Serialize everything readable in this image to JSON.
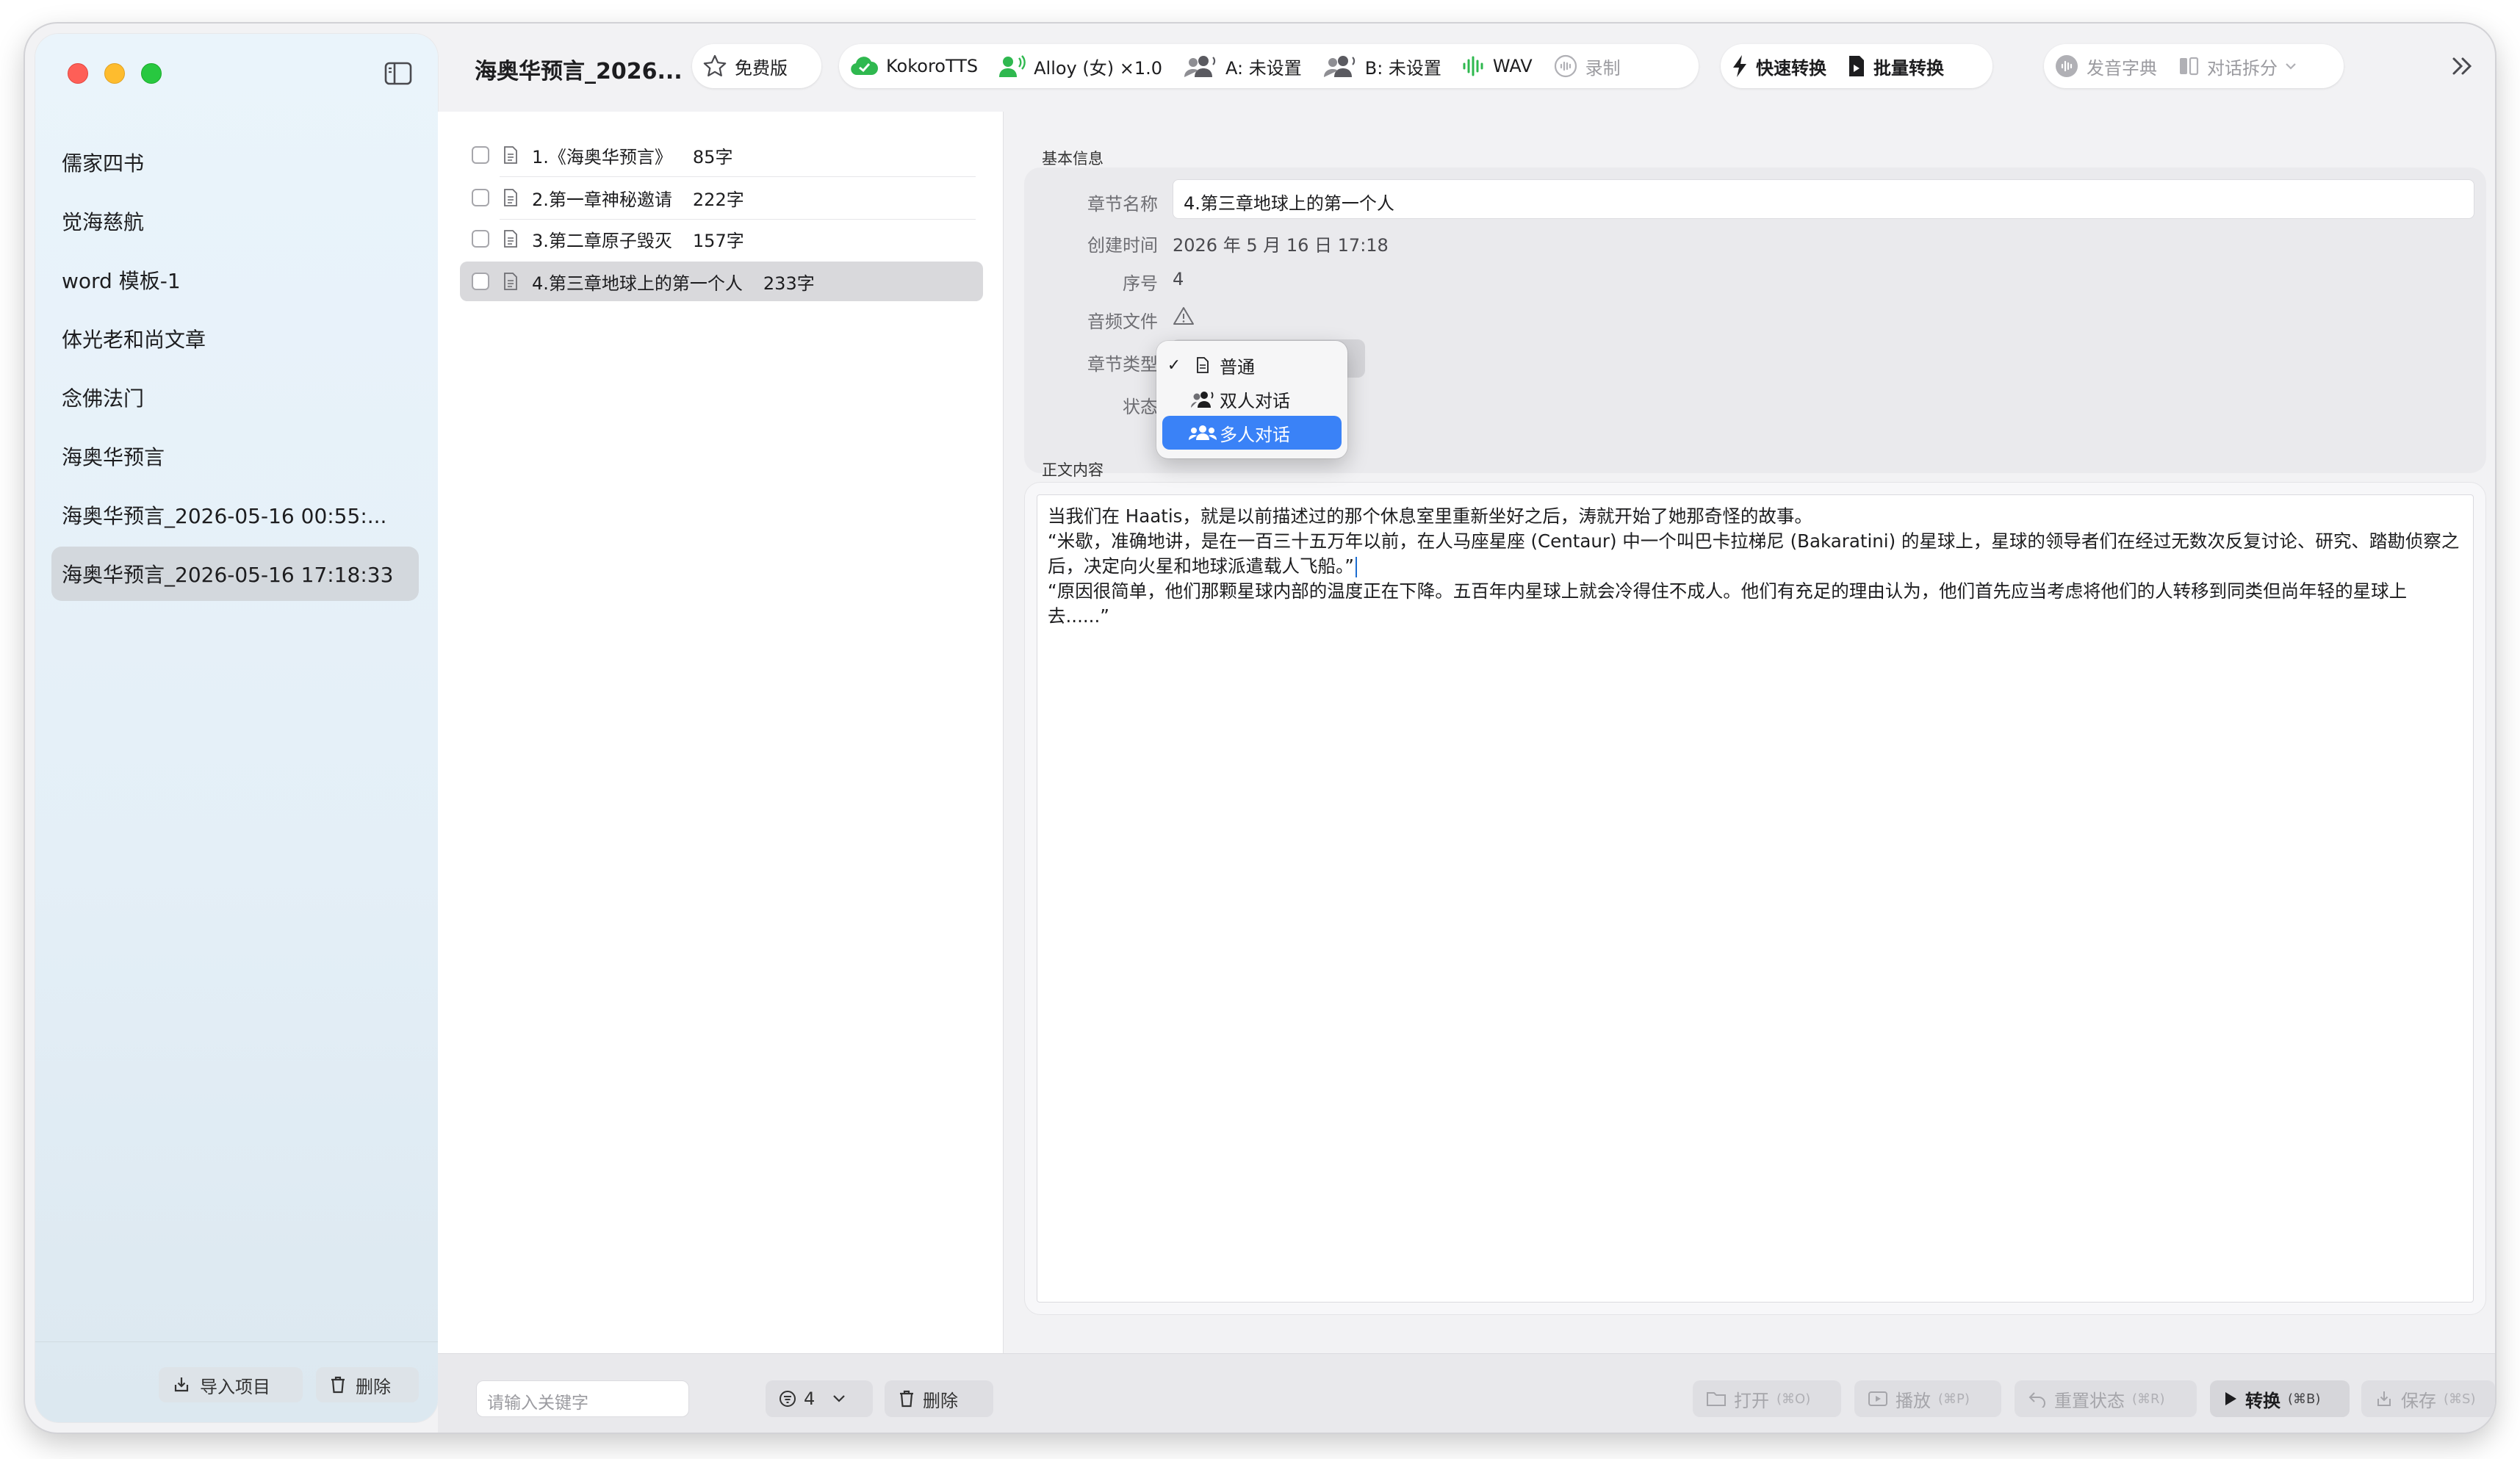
{
  "sidebar": {
    "projects": [
      {
        "label": "儒家四书"
      },
      {
        "label": "觉海慈航"
      },
      {
        "label": "word 模板-1"
      },
      {
        "label": "体光老和尚文章"
      },
      {
        "label": "念佛法门"
      },
      {
        "label": "海奥华预言"
      },
      {
        "label": "海奥华预言_2026-05-16 00:55:..."
      },
      {
        "label": "海奥华预言_2026-05-16 17:18:33"
      }
    ],
    "import_label": "导入项目",
    "delete_label": "删除"
  },
  "toolbar": {
    "title": "海奥华预言_2026...",
    "free_label": "免费版",
    "engine_label": "KokoroTTS",
    "voice_label": "Alloy (女) ×1.0",
    "speaker_a_label": "A: 未设置",
    "speaker_b_label": "B: 未设置",
    "format_label": "WAV",
    "record_label": "录制",
    "quick_convert_label": "快速转换",
    "batch_convert_label": "批量转换",
    "dictionary_label": "发音字典",
    "dialog_split_label": "对话拆分"
  },
  "chapters": [
    {
      "title": "1.《海奥华预言》",
      "count": "85字"
    },
    {
      "title": "2.第一章神秘邀请",
      "count": "222字"
    },
    {
      "title": "3.第二章原子毁灭",
      "count": "157字"
    },
    {
      "title": "4.第三章地球上的第一个人",
      "count": "233字"
    }
  ],
  "detail": {
    "basic_info_label": "基本信息",
    "name_label": "章节名称",
    "name_value": "4.第三章地球上的第一个人",
    "created_label": "创建时间",
    "created_value": "2026 年 5 月 16 日 17:18",
    "order_label": "序号",
    "order_value": "4",
    "audio_label": "音频文件",
    "type_label": "章节类型",
    "status_label": "状态",
    "content_label": "正文内容",
    "content_lines": [
      "当我们在 Haatis，就是以前描述过的那个休息室里重新坐好之后，涛就开始了她那奇怪的故事。",
      "“米歇，准确地讲，是在一百三十五万年以前，在人马座星座 (Centaur) 中一个叫巴卡拉梯尼 (Bakaratini) 的星球上，星球的领导者们在经过无数次反复讨论、研究、踏勘侦察之后，决定向火星和地球派遣载人飞船。”",
      "“原因很简单，他们那颗星球内部的温度正在下降。五百年内星球上就会冷得住不成人。他们有充足的理由认为，他们首先应当考虑将他们的人转移到同类但尚年轻的星球上去......”"
    ]
  },
  "type_menu": {
    "items": [
      {
        "label": "普通",
        "checked": true,
        "icon": "doc-icon"
      },
      {
        "label": "双人对话",
        "checked": false,
        "icon": "two-people-icon"
      },
      {
        "label": "多人对话",
        "checked": false,
        "icon": "group-icon"
      }
    ],
    "highlighted_index": 2,
    "check_mark": "✓"
  },
  "bottom": {
    "search_placeholder": "请输入关键字",
    "filter_count": "4",
    "delete_label": "删除",
    "open_label": "打开",
    "open_shortcut": "(⌘O)",
    "play_label": "播放",
    "play_shortcut": "(⌘P)",
    "reset_label": "重置状态",
    "reset_shortcut": "(⌘R)",
    "convert_label": "转换",
    "convert_shortcut": "(⌘B)",
    "save_label": "保存",
    "save_shortcut": "(⌘S)"
  },
  "colors": {
    "accent": "#3a82f7",
    "engine_green": "#2fb84f",
    "traffic_red": "#fe5f57",
    "traffic_yellow": "#febc2e",
    "traffic_green": "#28c840"
  }
}
